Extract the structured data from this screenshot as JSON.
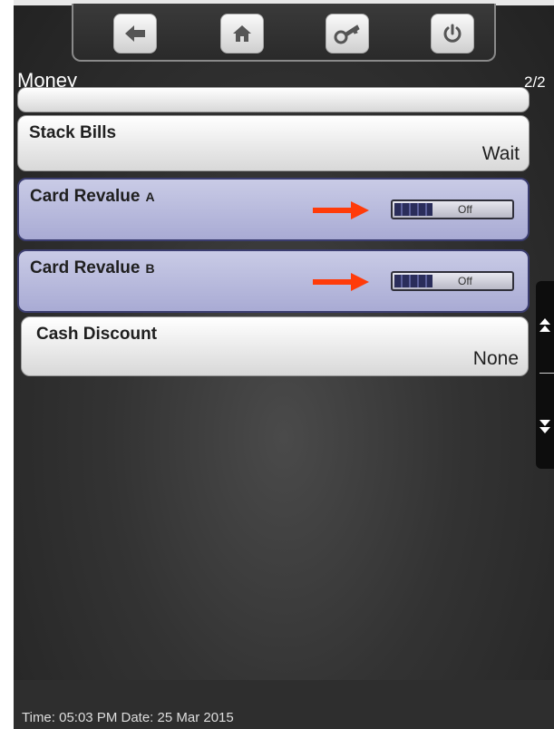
{
  "toolbar": {
    "buttons": [
      {
        "icon": "back-arrow-icon"
      },
      {
        "icon": "home-icon"
      },
      {
        "icon": "key-icon"
      },
      {
        "icon": "power-icon"
      }
    ]
  },
  "header": {
    "title": "Money",
    "page_indicator": "2/2"
  },
  "rows": {
    "stack_bills": {
      "label": "Stack Bills",
      "value": "Wait"
    },
    "card_revalue_a": {
      "label": "Card Revalue",
      "suffix": "A",
      "toggle": "Off"
    },
    "card_revalue_b": {
      "label": "Card Revalue",
      "suffix": "B",
      "toggle": "Off"
    },
    "cash_discount": {
      "label": "Cash Discount",
      "value": "None"
    }
  },
  "footer": {
    "status": "Time: 05:03 PM Date: 25 Mar 2015"
  },
  "colors": {
    "highlight_row": "#b6b8dc",
    "annotation_arrow": "#ff3b0a",
    "background": "#333333"
  }
}
